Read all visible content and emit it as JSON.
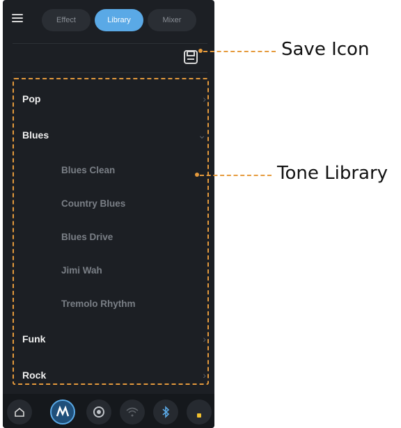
{
  "tabs": [
    {
      "label": "Effect",
      "active": false
    },
    {
      "label": "Library",
      "active": true
    },
    {
      "label": "Mixer",
      "active": false
    }
  ],
  "library": {
    "categories": [
      {
        "label": "Pop",
        "expanded": false
      },
      {
        "label": "Blues",
        "expanded": true
      },
      {
        "label": "Funk",
        "expanded": false
      },
      {
        "label": "Rock",
        "expanded": false
      }
    ],
    "blues_tones": [
      "Blues Clean",
      "Country Blues",
      "Blues Drive",
      "Jimi Wah",
      "Tremolo Rhythm"
    ]
  },
  "bottom_nav": [
    {
      "icon": "home-icon"
    },
    {
      "icon": "logo-icon",
      "active": true
    },
    {
      "icon": "tuner-icon"
    },
    {
      "icon": "wifi-icon"
    },
    {
      "icon": "bluetooth-icon"
    },
    {
      "icon": "battery-indicator-icon"
    }
  ],
  "callouts": {
    "save": "Save Icon",
    "library": "Tone Library"
  },
  "colors": {
    "background": "#1c1f24",
    "accent": "#5aa9e6",
    "callout": "#e59a3c"
  }
}
